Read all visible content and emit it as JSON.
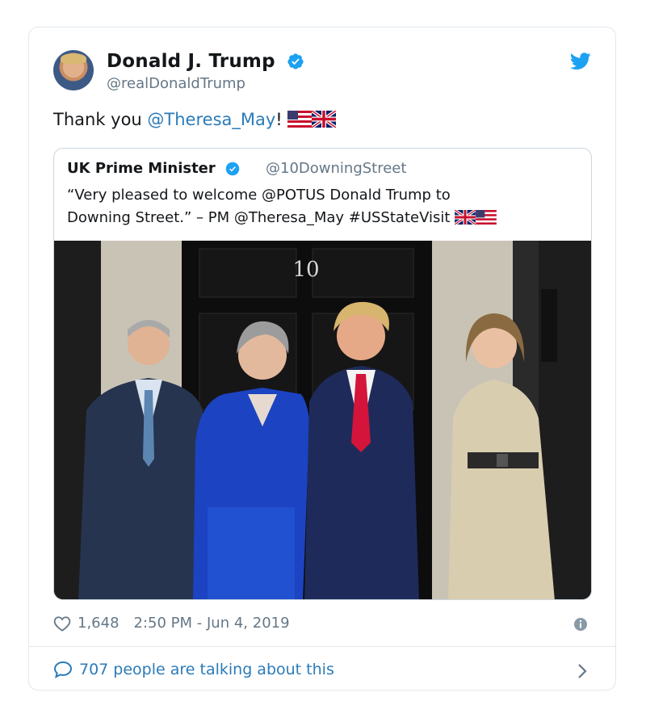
{
  "tweet": {
    "author_name": "Donald J. Trump",
    "author_handle": "@realDonaldTrump",
    "text_prefix": "Thank you ",
    "mention": "@Theresa_May",
    "text_suffix": "!",
    "likes": "1,648",
    "timestamp": "2:50 PM - Jun 4, 2019",
    "talking": "707 people are talking about this"
  },
  "quoted": {
    "author_name": "UK Prime Minister",
    "author_handle": "@10DowningStreet",
    "text_line1": "“Very pleased to welcome @POTUS Donald Trump to",
    "text_line2": "Downing Street.” – PM @Theresa_May #USStateVisit",
    "door_number": "10"
  },
  "colors": {
    "link": "#2b7bb9",
    "verified": "#1da1f2",
    "muted": "#657786",
    "border": "#e1e8ed"
  },
  "icons": [
    "verified-icon",
    "twitter-bird-icon",
    "heart-icon",
    "info-icon",
    "speech-bubble-icon",
    "chevron-right-icon",
    "us-flag-icon",
    "uk-flag-icon"
  ]
}
